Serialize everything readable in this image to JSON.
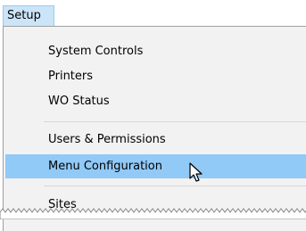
{
  "menubar": {
    "active_menu": "Setup"
  },
  "menu": {
    "items": [
      {
        "label": "System Controls"
      },
      {
        "label": "Printers"
      },
      {
        "label": "WO Status"
      },
      {
        "label": "Users & Permissions"
      },
      {
        "label": "Menu Configuration"
      },
      {
        "label": "Sites"
      }
    ],
    "highlighted_index": 4
  },
  "colors": {
    "menu_background": "#f2f2f2",
    "highlight": "#91c9f7",
    "active_menu_background": "#cce4f7"
  },
  "icons": {
    "cursor": "mouse-pointer-icon"
  }
}
